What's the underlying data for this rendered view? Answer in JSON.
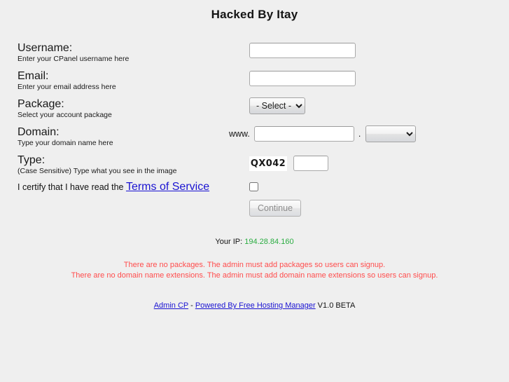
{
  "page": {
    "title": "Hacked By Itay",
    "background_color": "#efefef"
  },
  "form": {
    "fields": [
      {
        "label": "Username:",
        "hint": "Enter your CPanel username here",
        "value": "",
        "placeholder": ""
      },
      {
        "label": "Email:",
        "hint": "Enter your email address here",
        "value": "",
        "placeholder": ""
      },
      {
        "label": "Package:",
        "hint": "Select your account package",
        "selected_option": "- Select -"
      },
      {
        "label": "Domain:",
        "hint": "Type your domain name here",
        "prefix": "www.",
        "separator": ".",
        "value": "",
        "placeholder": "",
        "extension_selected": ""
      },
      {
        "label": "Type:",
        "hint": "(Case Sensitive) Type what you see in the image",
        "captcha_text": "QX042",
        "value": "",
        "placeholder": ""
      }
    ],
    "certify": {
      "text": "I certify that I have read the ",
      "link_label": "Terms of Service",
      "checked": false
    },
    "submit_label": "Continue"
  },
  "status": {
    "ip_label": "Your IP: ",
    "ip_value": "194.28.84.160",
    "ip_color": "#2bad42",
    "errors": [
      "There are no packages. The admin must add packages so users can signup.",
      "There are no domain name extensions. The admin must add domain name extensions so users can signup."
    ],
    "error_color": "#ff4d4d"
  },
  "footer": {
    "admin_link": "Admin CP",
    "separator": " - ",
    "powered_link": "Powered By Free Hosting Manager",
    "version": " V1.0 BETA",
    "link_color": "#1a13d2"
  }
}
